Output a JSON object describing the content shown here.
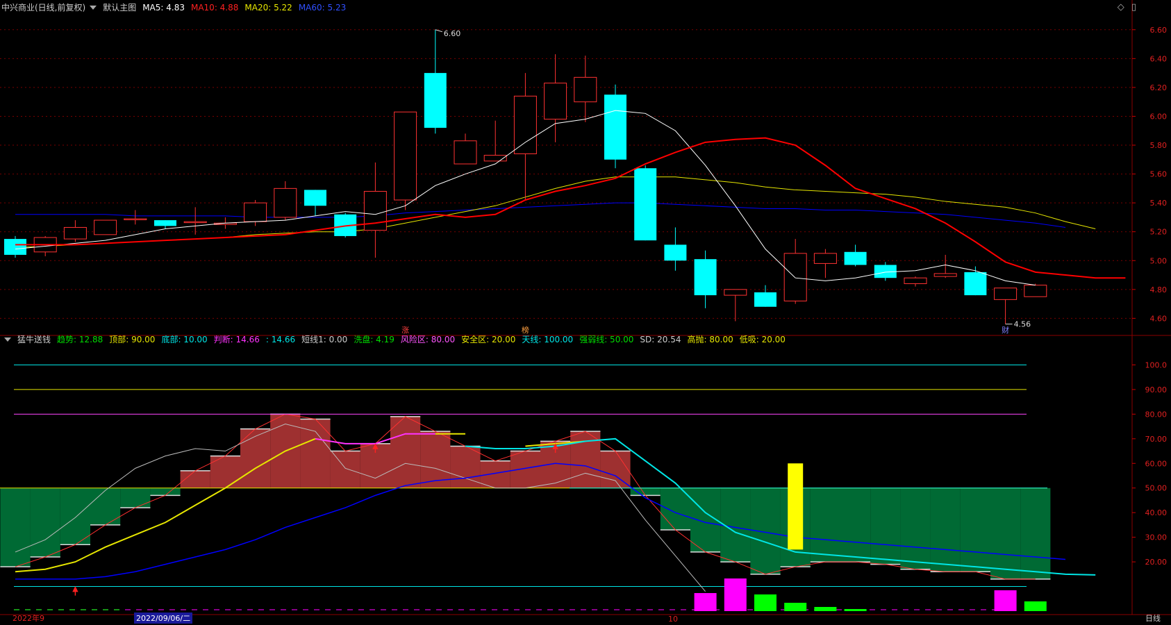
{
  "header": {
    "title": "中兴商业(日线,前复权)",
    "main_chart_label": "默认主图",
    "ma5_label": "MA5: 4.83",
    "ma10_label": "MA10: 4.88",
    "ma20_label": "MA20: 5.22",
    "ma60_label": "MA60: 5.23"
  },
  "indicator_header": {
    "name": "猛牛送钱",
    "items": [
      {
        "text": "趋势: 12.88",
        "color": "#00dd00"
      },
      {
        "text": "顶部: 90.00",
        "color": "#e6e600"
      },
      {
        "text": "底部: 10.00",
        "color": "#00e6e6"
      },
      {
        "text": "判断: 14.66",
        "color": "#ff33ff"
      },
      {
        "text": ": 14.66",
        "color": "#00e6e6"
      },
      {
        "text": "短线1: 0.00",
        "color": "#cccccc"
      },
      {
        "text": "洗盘: 4.19",
        "color": "#00dd00"
      },
      {
        "text": "风险区: 80.00",
        "color": "#ff55ff"
      },
      {
        "text": "安全区: 20.00",
        "color": "#e6e600"
      },
      {
        "text": "天线: 100.00",
        "color": "#00e6e6"
      },
      {
        "text": "强弱线: 50.00",
        "color": "#00dd00"
      },
      {
        "text": "SD: 20.54",
        "color": "#cccccc"
      },
      {
        "text": "高抛: 80.00",
        "color": "#e6e600"
      },
      {
        "text": "低吸: 20.00",
        "color": "#e6e600"
      }
    ]
  },
  "price_axis": [
    "6.60",
    "6.40",
    "6.20",
    "6.00",
    "5.80",
    "5.60",
    "5.40",
    "5.20",
    "5.00",
    "4.80",
    "4.60"
  ],
  "ind_axis": [
    "100.0",
    "90.00",
    "80.00",
    "70.00",
    "60.00",
    "50.00",
    "40.00",
    "30.00",
    "20.00"
  ],
  "annotations": {
    "high_label": "6.60",
    "low_label": "4.56"
  },
  "event_marks": [
    {
      "text": "涨",
      "color": "#ff4040",
      "index": 13
    },
    {
      "text": "榜",
      "color": "#ffa040",
      "index": 17
    },
    {
      "text": "财",
      "color": "#8080ff",
      "index": 33
    }
  ],
  "date_bar": {
    "left": "2022年9",
    "selected": "2022/09/06/二",
    "month": "10",
    "period": "日线"
  },
  "colors": {
    "up": "#ff3232",
    "down": "#00ffff",
    "ma5": "#ffffff",
    "ma10": "#ff0000",
    "ma20": "#e6e600",
    "ma60": "#0000ff",
    "grid": "#7a0000",
    "axis": "#8b0000"
  },
  "chart_data": {
    "type": "candlestick",
    "candles": [
      {
        "o": 5.15,
        "h": 5.17,
        "l": 5.02,
        "c": 5.04
      },
      {
        "o": 5.06,
        "h": 5.17,
        "l": 5.03,
        "c": 5.16
      },
      {
        "o": 5.15,
        "h": 5.28,
        "l": 5.13,
        "c": 5.23
      },
      {
        "o": 5.18,
        "h": 5.28,
        "l": 5.18,
        "c": 5.28
      },
      {
        "o": 5.29,
        "h": 5.35,
        "l": 5.25,
        "c": 5.29
      },
      {
        "o": 5.28,
        "h": 5.28,
        "l": 5.22,
        "c": 5.24
      },
      {
        "o": 5.27,
        "h": 5.37,
        "l": 5.18,
        "c": 5.27
      },
      {
        "o": 5.25,
        "h": 5.3,
        "l": 5.22,
        "c": 5.26
      },
      {
        "o": 5.27,
        "h": 5.42,
        "l": 5.24,
        "c": 5.4
      },
      {
        "o": 5.3,
        "h": 5.55,
        "l": 5.28,
        "c": 5.5
      },
      {
        "o": 5.49,
        "h": 5.49,
        "l": 5.31,
        "c": 5.38
      },
      {
        "o": 5.32,
        "h": 5.33,
        "l": 5.16,
        "c": 5.17
      },
      {
        "o": 5.21,
        "h": 5.68,
        "l": 5.02,
        "c": 5.48
      },
      {
        "o": 5.42,
        "h": 6.03,
        "l": 5.35,
        "c": 6.03
      },
      {
        "o": 6.3,
        "h": 6.6,
        "l": 5.88,
        "c": 5.92
      },
      {
        "o": 5.67,
        "h": 5.88,
        "l": 5.67,
        "c": 5.83
      },
      {
        "o": 5.69,
        "h": 5.97,
        "l": 5.69,
        "c": 5.73
      },
      {
        "o": 5.74,
        "h": 6.3,
        "l": 5.42,
        "c": 6.14
      },
      {
        "o": 5.98,
        "h": 6.43,
        "l": 5.82,
        "c": 6.23
      },
      {
        "o": 6.1,
        "h": 6.42,
        "l": 5.96,
        "c": 6.27
      },
      {
        "o": 6.15,
        "h": 6.22,
        "l": 5.64,
        "c": 5.7
      },
      {
        "o": 5.64,
        "h": 5.66,
        "l": 5.14,
        "c": 5.14
      },
      {
        "o": 5.11,
        "h": 5.23,
        "l": 4.93,
        "c": 5.0
      },
      {
        "o": 5.01,
        "h": 5.07,
        "l": 4.67,
        "c": 4.76
      },
      {
        "o": 4.76,
        "h": 4.8,
        "l": 4.58,
        "c": 4.8
      },
      {
        "o": 4.78,
        "h": 4.83,
        "l": 4.68,
        "c": 4.68
      },
      {
        "o": 4.72,
        "h": 5.15,
        "l": 4.7,
        "c": 5.05
      },
      {
        "o": 4.98,
        "h": 5.08,
        "l": 4.88,
        "c": 5.05
      },
      {
        "o": 5.06,
        "h": 5.11,
        "l": 4.96,
        "c": 4.97
      },
      {
        "o": 4.97,
        "h": 4.99,
        "l": 4.86,
        "c": 4.88
      },
      {
        "o": 4.84,
        "h": 4.89,
        "l": 4.82,
        "c": 4.88
      },
      {
        "o": 4.89,
        "h": 5.04,
        "l": 4.88,
        "c": 4.91
      },
      {
        "o": 4.92,
        "h": 4.96,
        "l": 4.76,
        "c": 4.76
      },
      {
        "o": 4.73,
        "h": 4.8,
        "l": 4.56,
        "c": 4.81
      },
      {
        "o": 4.75,
        "h": 4.84,
        "l": 4.75,
        "c": 4.83
      }
    ],
    "ma5": [
      5.08,
      5.1,
      5.12,
      5.14,
      5.18,
      5.22,
      5.24,
      5.26,
      5.27,
      5.28,
      5.31,
      5.34,
      5.32,
      5.38,
      5.52,
      5.6,
      5.67,
      5.82,
      5.95,
      5.98,
      6.04,
      6.02,
      5.9,
      5.66,
      5.38,
      5.08,
      4.88,
      4.86,
      4.88,
      4.92,
      4.93,
      4.97,
      4.93,
      4.86,
      4.83
    ],
    "ma10": [
      5.11,
      5.11,
      5.11,
      5.12,
      5.13,
      5.14,
      5.15,
      5.16,
      5.17,
      5.18,
      5.21,
      5.24,
      5.26,
      5.29,
      5.32,
      5.3,
      5.32,
      5.42,
      5.48,
      5.52,
      5.57,
      5.67,
      5.75,
      5.82,
      5.84,
      5.85,
      5.8,
      5.66,
      5.5,
      5.43,
      5.36,
      5.26,
      5.13,
      4.99,
      4.92,
      4.9,
      4.88,
      4.88
    ],
    "ma20": [
      5.09,
      5.1,
      5.11,
      5.12,
      5.13,
      5.14,
      5.15,
      5.16,
      5.18,
      5.19,
      5.2,
      5.2,
      5.22,
      5.26,
      5.3,
      5.34,
      5.38,
      5.44,
      5.5,
      5.55,
      5.58,
      5.58,
      5.58,
      5.56,
      5.54,
      5.51,
      5.49,
      5.48,
      5.47,
      5.46,
      5.44,
      5.41,
      5.39,
      5.37,
      5.33,
      5.27,
      5.22
    ],
    "ma60": [
      5.32,
      5.32,
      5.32,
      5.32,
      5.31,
      5.31,
      5.31,
      5.31,
      5.3,
      5.3,
      5.3,
      5.3,
      5.31,
      5.33,
      5.34,
      5.35,
      5.36,
      5.37,
      5.38,
      5.39,
      5.4,
      5.4,
      5.39,
      5.38,
      5.37,
      5.36,
      5.36,
      5.35,
      5.35,
      5.34,
      5.33,
      5.32,
      5.3,
      5.28,
      5.26,
      5.23
    ],
    "ylim": [
      4.52,
      6.7
    ],
    "indicator": {
      "ylim": [
        0,
        110
      ],
      "trend_bars": [
        18,
        22,
        27,
        35,
        42,
        47,
        57,
        63,
        74,
        80,
        78,
        65,
        68,
        79,
        73,
        67,
        61,
        65,
        69,
        73,
        65,
        47,
        33,
        24,
        20,
        15,
        18,
        20,
        20,
        19,
        17,
        16,
        16,
        13,
        13
      ],
      "strong_weak": 50,
      "lines": {
        "top": 90,
        "risk": 80,
        "sky": 100,
        "bottom": 10
      },
      "white_line": [
        24,
        29,
        38,
        49,
        58,
        63,
        66,
        65,
        71,
        76,
        73,
        58,
        54,
        60,
        58,
        54,
        50,
        50,
        52,
        56,
        53,
        37,
        0,
        0,
        0,
        0,
        0,
        0,
        0,
        0,
        0,
        0,
        0,
        0,
        0
      ],
      "yellow_line": [
        16,
        17,
        20,
        26,
        31,
        36,
        43,
        50,
        58,
        65,
        70
      ],
      "mag_line": [
        70,
        68,
        68,
        72,
        72
      ],
      "cyan_line": [
        67,
        66,
        66,
        67,
        69,
        70,
        61,
        52,
        40,
        32,
        28,
        24,
        23,
        22,
        21,
        20,
        19,
        18,
        17,
        16,
        15,
        14.7
      ],
      "blue_line": [
        13,
        13,
        13,
        14,
        16,
        19,
        22,
        25,
        29,
        34,
        38,
        42,
        47,
        51,
        53,
        54,
        56,
        58,
        60,
        59,
        55,
        46,
        40,
        36,
        34,
        32,
        30,
        29,
        28,
        27,
        26,
        25,
        24,
        23,
        22,
        21
      ],
      "yellow_bar": {
        "index": 26,
        "from": 25,
        "to": 60
      },
      "volume_bars": [
        {
          "index": 23,
          "h": 26,
          "color": "#ff00ff"
        },
        {
          "index": 24,
          "h": 47,
          "color": "#ff00ff"
        },
        {
          "index": 25,
          "h": 24,
          "color": "#00ff00"
        },
        {
          "index": 26,
          "h": 12,
          "color": "#00ff00"
        },
        {
          "index": 27,
          "h": 6,
          "color": "#00ff00"
        },
        {
          "index": 28,
          "h": 3,
          "color": "#00ff00"
        },
        {
          "index": 33,
          "h": 30,
          "color": "#ff00ff"
        },
        {
          "index": 34,
          "h": 14,
          "color": "#00ff00"
        }
      ]
    }
  }
}
